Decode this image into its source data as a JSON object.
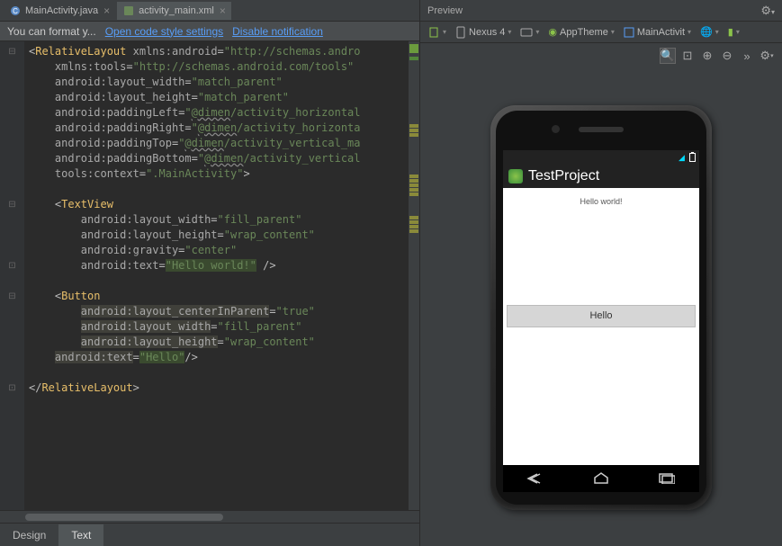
{
  "tabs": {
    "t1": "MainActivity.java",
    "t2": "activity_main.xml"
  },
  "notif": {
    "msg": "You can format y...",
    "link1": "Open code style settings",
    "link2": "Disable notification"
  },
  "bottomTabs": {
    "design": "Design",
    "text": "Text"
  },
  "preview": {
    "title": "Preview",
    "device": "Nexus 4",
    "theme": "AppTheme",
    "activity": "MainActivit"
  },
  "app": {
    "title": "TestProject",
    "hello": "Hello world!",
    "button": "Hello"
  },
  "code": {
    "l1a": "RelativeLayout",
    "l1b": "xmlns:android",
    "l1c": "\"http://schemas.andro",
    "l2a": "xmlns:tools",
    "l2b": "\"http://schemas.android.com/tools\"",
    "l3a": "android:layout_width",
    "l3b": "\"match_parent\"",
    "l4a": "android:layout_height",
    "l4b": "\"match_parent\"",
    "l5a": "android:paddingLeft",
    "l5b": "@dimen",
    "l5c": "/activity_horizontal",
    "l6a": "android:paddingRight",
    "l6b": "@dimen",
    "l6c": "/activity_horizonta",
    "l7a": "android:paddingTop",
    "l7b": "@dimen",
    "l7c": "/activity_vertical_ma",
    "l8a": "android:paddingBottom",
    "l8b": "@dimen",
    "l8c": "/activity_vertical",
    "l9a": "tools:context",
    "l9b": "\".MainActivity\"",
    "l11": "TextView",
    "l12a": "android:layout_width",
    "l12b": "\"fill_parent\"",
    "l13a": "android:layout_height",
    "l13b": "\"wrap_content\"",
    "l14a": "android:gravity",
    "l14b": "\"center\"",
    "l15a": "android:text",
    "l15b": "\"Hello world!\"",
    "l17": "Button",
    "l18a": "android:layout_centerInParent",
    "l18b": "\"true\"",
    "l19a": "android:layout_width",
    "l19b": "\"fill_parent\"",
    "l20a": "android:layout_height",
    "l20b": "\"wrap_content\"",
    "l21a": "android:text",
    "l21b": "\"Hello\"",
    "l23": "RelativeLayout"
  }
}
